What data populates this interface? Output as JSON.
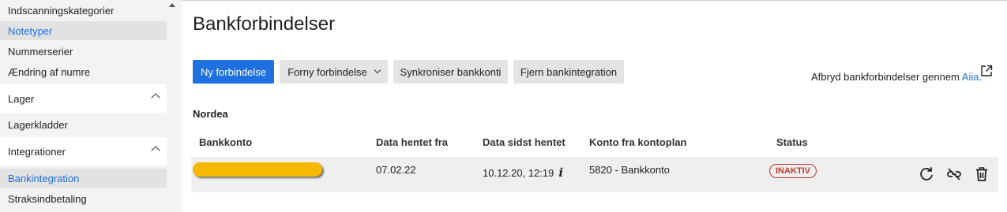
{
  "sidebar": {
    "items": [
      {
        "label": "Indscanningskategorier"
      },
      {
        "label": "Notetyper"
      },
      {
        "label": "Nummerserier"
      },
      {
        "label": "Ændring af numre"
      },
      {
        "label": "Lagerkladder"
      },
      {
        "label": "Bankintegration"
      },
      {
        "label": "Straksindbetaling"
      }
    ],
    "groups": [
      {
        "label": "Lager"
      },
      {
        "label": "Integrationer"
      }
    ],
    "active_color": "#1f6fd6"
  },
  "main": {
    "title": "Bankforbindelser",
    "toolbar": {
      "new_label": "Ny forbindelse",
      "renew_label": "Forny forbindelse",
      "sync_label": "Synkroniser bankkonti",
      "remove_label": "Fjern bankintegration"
    },
    "external": {
      "text": "Afbryd bankforbindelser gennem ",
      "link": "Aiia."
    },
    "bank_name": "Nordea",
    "table": {
      "headers": [
        "Bankkonto",
        "Data hentet fra",
        "Data sidst hentet",
        "Konto fra kontoplan",
        "Status"
      ],
      "rows": [
        {
          "account": "",
          "from": "07.02.22",
          "last": "10.12.20, 12:19",
          "ledger": "5820 - Bankkonto",
          "status": "INAKTIV"
        }
      ]
    },
    "colors": {
      "primary": "#1e6fe0",
      "status_inactive": "#c0392b",
      "redaction": "#f6b800"
    }
  }
}
